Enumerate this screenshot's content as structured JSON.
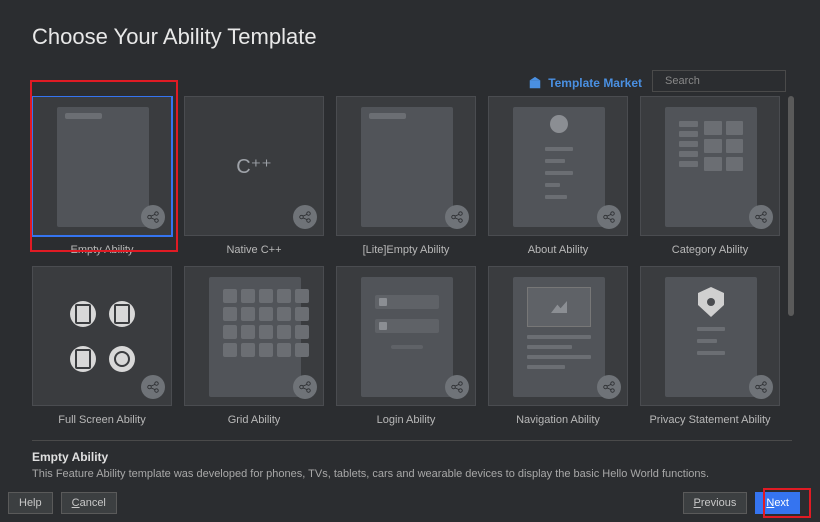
{
  "title": "Choose Your Ability Template",
  "market_link": "Template Market",
  "search": {
    "placeholder": "Search"
  },
  "templates": [
    {
      "label": "Empty Ability",
      "selected": true
    },
    {
      "label": "Native C++"
    },
    {
      "label": "[Lite]Empty Ability"
    },
    {
      "label": "About Ability"
    },
    {
      "label": "Category Ability"
    },
    {
      "label": "Full Screen Ability"
    },
    {
      "label": "Grid Ability"
    },
    {
      "label": "Login Ability"
    },
    {
      "label": "Navigation Ability"
    },
    {
      "label": "Privacy Statement Ability"
    }
  ],
  "description": {
    "title": "Empty Ability",
    "text": "This Feature Ability template was developed for phones, TVs, tablets, cars and wearable devices to display the basic Hello World functions."
  },
  "footer": {
    "help": "Help",
    "cancel": "Cancel",
    "previous": "Previous",
    "next": "Next"
  }
}
